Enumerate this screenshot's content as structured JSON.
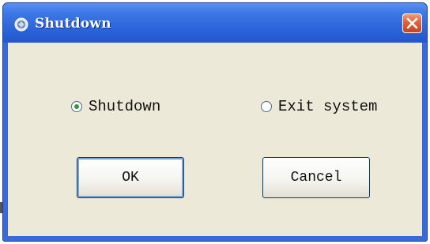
{
  "window": {
    "title": "Shutdown",
    "icon": "app-icon",
    "close_icon": "close-icon"
  },
  "options": {
    "shutdown_label": "Shutdown",
    "exit_label": "Exit system",
    "selected": "Shutdown"
  },
  "buttons": {
    "ok_label": "OK",
    "cancel_label": "Cancel"
  },
  "colors": {
    "titlebar": "#2a62d8",
    "close": "#e0603c",
    "dialog_bg": "#ece9d8",
    "radio_selected": "#2f9a3a"
  }
}
